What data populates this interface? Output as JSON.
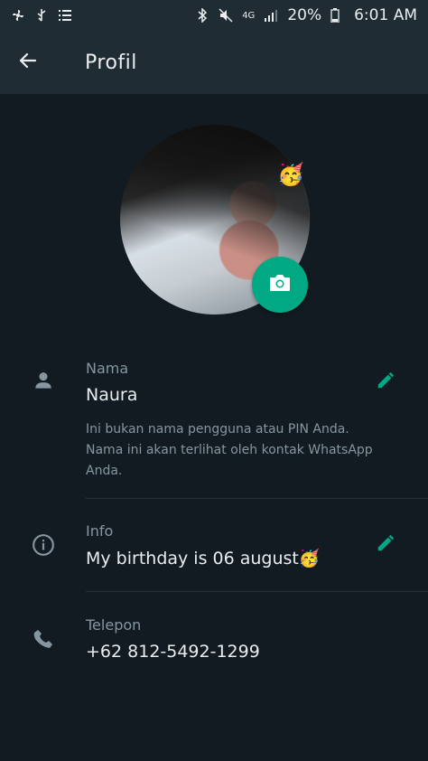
{
  "status_bar": {
    "left_icons": [
      "fan-icon",
      "usb-icon",
      "notification-list-icon"
    ],
    "right_icons": [
      "bluetooth-icon",
      "mute-icon",
      "network-4g-icon",
      "signal-icon",
      "battery-icon"
    ],
    "network": "4G",
    "battery": "20%",
    "time": "6:01 AM"
  },
  "app_bar": {
    "title": "Profil",
    "back_icon": "arrow-left-icon"
  },
  "profile": {
    "sticker": "🥳",
    "camera_icon": "camera-icon"
  },
  "rows": {
    "name": {
      "label": "Nama",
      "value": "Naura",
      "hint": "Ini bukan nama pengguna atau PIN Anda. Nama ini akan terlihat oleh kontak WhatsApp Anda.",
      "icon": "person-icon"
    },
    "info": {
      "label": "Info",
      "value": "My birthday is 06 august🥳",
      "icon": "info-icon"
    },
    "phone": {
      "label": "Telepon",
      "value": "+62 812-5492-1299",
      "icon": "phone-icon"
    }
  },
  "colors": {
    "accent": "#00a884",
    "background": "#121b22",
    "header": "#1f2c34"
  }
}
